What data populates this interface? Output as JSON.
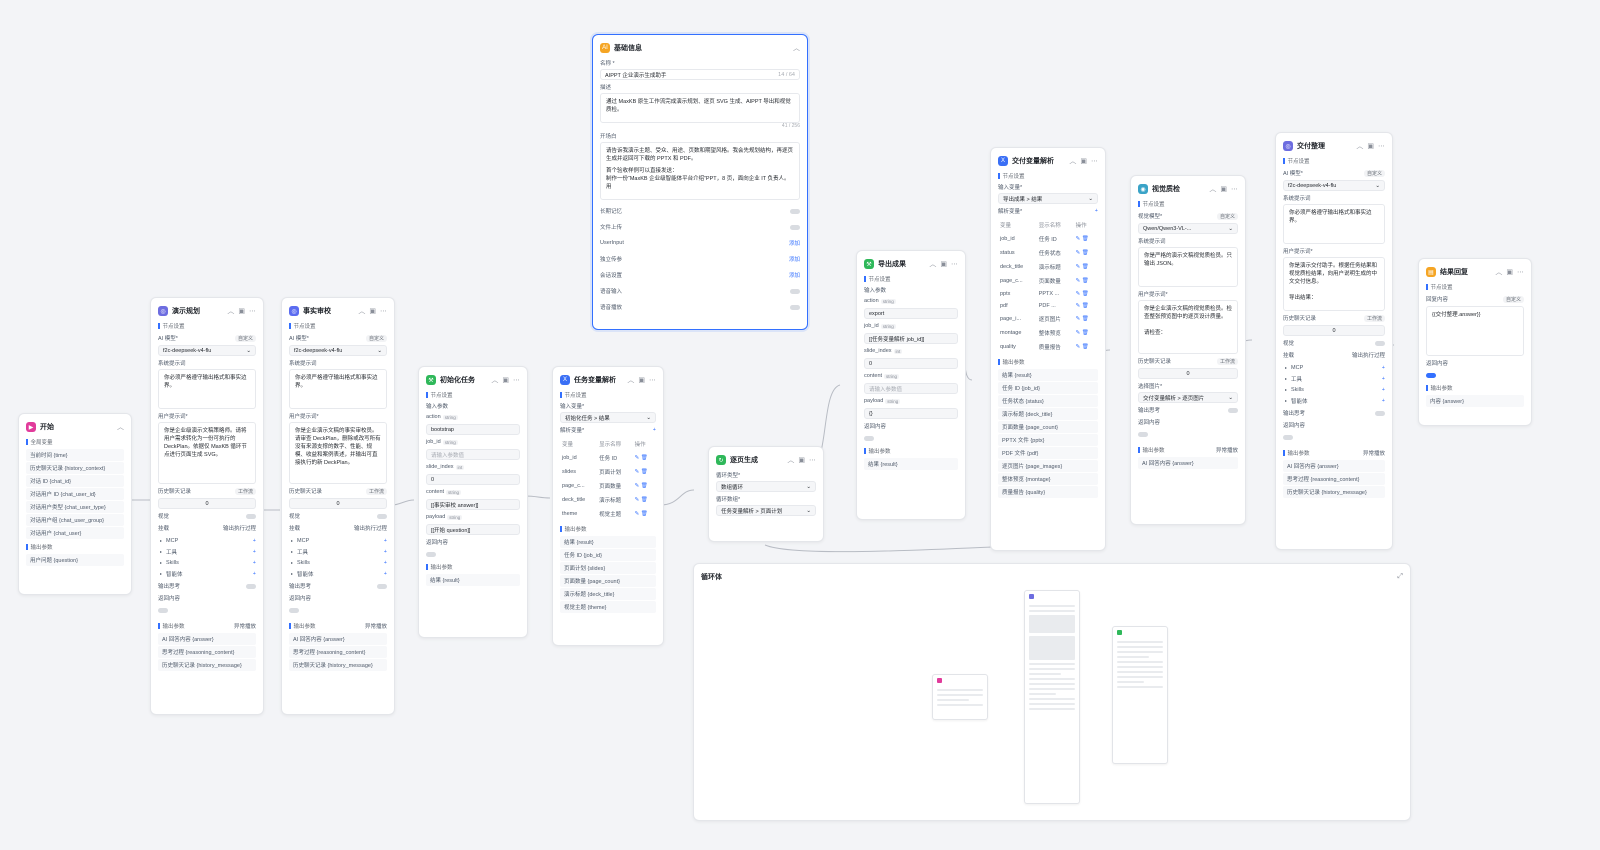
{
  "colors": {
    "accent": "#3370ff",
    "start": "#e13b9b",
    "ai": "#6d6de0",
    "fact": "#5b6cf0",
    "init": "#2fb85a",
    "var": "#3a6ff5",
    "export": "#2fb85a",
    "page": "#2fb85a",
    "base": "#f5a524",
    "deliver": "#3a6ff5",
    "visual": "#3aa3c7",
    "deliver2": "#6d6de0",
    "result": "#f5a524"
  },
  "start": {
    "title": "开始",
    "sec_global": "全局变量",
    "vars": [
      "当前时间 {time}",
      "历史聊天记录 {history_context}",
      "对话 ID {chat_id}",
      "对话用户 ID {chat_user_id}",
      "对话用户类型 {chat_user_type}",
      "对话用户组 {chat_user_group}",
      "对话用户 {chat_user}"
    ],
    "sec_out": "输出参数",
    "out": [
      "用户问题 {question}"
    ]
  },
  "plan": {
    "title": "演示规划",
    "sec_node": "节点设置",
    "model_label": "AI 模型*",
    "model_tag": "自定义",
    "model": "f2c-deepseek-v4-flu",
    "sys_label": "系统提示词",
    "sys": "你必须严格遵守输出格式和事实边界。",
    "user_label": "用户提示词*",
    "user": "你是企业级演示文稿策略师。请将用户需求转化为一份可执行的 DeckPlan。依据仅 MaxKB 循环节点进行页面生成 SVG。",
    "hist_label": "历史聊天记录",
    "hist_mode": "工作流",
    "hist_val": "0",
    "vision": "视觉",
    "mount": "挂载",
    "exec_label": "输出执行过程",
    "tools": [
      "MCP",
      "工具",
      "Skills",
      "智能体"
    ],
    "think": "输出思考",
    "ret": "返回内容",
    "sec_out": "输出参数",
    "stream": "异常播放",
    "out": [
      "AI 回答内容 {answer}",
      "思考过程 {reasoning_content}",
      "历史聊天记录 {history_message}"
    ]
  },
  "fact": {
    "title": "事实审校",
    "sec_node": "节点设置",
    "model_label": "AI 模型*",
    "model_tag": "自定义",
    "model": "f2c-deepseek-v4-flu",
    "sys_label": "系统提示词",
    "sys": "你必须严格遵守输出格式和事实边界。",
    "user_label": "用户提示词*",
    "user": "你是企业演示文稿的事实审校员。请审查 DeckPlan，删除或改写所有没有来源支撑的数字、性能、规模、收益和案例表述，并输出可直接执行的新 DeckPlan。",
    "hist_label": "历史聊天记录",
    "hist_mode": "工作流",
    "hist_val": "0",
    "vision": "视觉",
    "mount": "挂载",
    "exec_label": "输出执行过程",
    "tools": [
      "MCP",
      "工具",
      "Skills",
      "智能体"
    ],
    "think": "输出思考",
    "ret": "返回内容",
    "sec_out": "输出参数",
    "stream": "异常播放",
    "out": [
      "AI 回答内容 {answer}",
      "思考过程 {reasoning_content}",
      "历史聊天记录 {history_message}"
    ]
  },
  "init": {
    "title": "初始化任务",
    "sec_node": "节点设置",
    "sec_in": "输入参数",
    "params": [
      {
        "name": "action",
        "type": "string",
        "value": "bootstrap",
        "ph": false
      },
      {
        "name": "job_id",
        "type": "string",
        "value": "请输入参数值",
        "ph": true
      },
      {
        "name": "slide_index",
        "type": "int",
        "value": "0",
        "ph": false
      },
      {
        "name": "content",
        "type": "string",
        "value": "[[事实审校 answer]]",
        "ph": false
      },
      {
        "name": "payload",
        "type": "string",
        "value": "[[开始 question]]",
        "ph": false
      }
    ],
    "ret": "返回内容",
    "sec_out": "输出参数",
    "out": [
      "结果 {result}"
    ]
  },
  "taskvar": {
    "title": "任务变量解析",
    "sec_node": "节点设置",
    "in_label": "输入变量*",
    "in_val": "初始化任务 > 结果",
    "parse_label": "解析变量*",
    "cols": [
      "变量",
      "显示名称",
      "操作"
    ],
    "rows": [
      [
        "job_id",
        "任务 ID"
      ],
      [
        "slides",
        "页面计划"
      ],
      [
        "page_c...",
        "页面数量"
      ],
      [
        "deck_title",
        "演示标题"
      ],
      [
        "theme",
        "视觉主题"
      ]
    ],
    "sec_out": "输出参数",
    "out": [
      "结果 {result}",
      "任务 ID {job_id}",
      "页面计划 {slides}",
      "页面数量 {page_count}",
      "演示标题 {deck_title}",
      "视觉主题 {theme}"
    ]
  },
  "pagegen": {
    "title": "逐页生成",
    "loop_label": "循环类型*",
    "loop_val": "数组循环",
    "arr_label": "循环数组*",
    "arr_val": "任务变量解析 > 页面计划"
  },
  "export": {
    "title": "导出成果",
    "sec_node": "节点设置",
    "sec_in": "输入参数",
    "params": [
      {
        "name": "action",
        "type": "string",
        "value": "export",
        "ph": false
      },
      {
        "name": "job_id",
        "type": "string",
        "value": "[[任务变量解析 job_id]]",
        "ph": false
      },
      {
        "name": "slide_index",
        "type": "int",
        "value": "0",
        "ph": false
      },
      {
        "name": "content",
        "type": "string",
        "value": "请输入参数值",
        "ph": true
      },
      {
        "name": "payload",
        "type": "string",
        "value": "{}",
        "ph": false
      }
    ],
    "ret": "返回内容",
    "sec_out": "输出参数",
    "out": [
      "结果 {result}"
    ]
  },
  "base": {
    "title": "基础信息",
    "name_label": "名称 *",
    "name": "AIPPT 企业演示生成助手",
    "name_count": "14 / 64",
    "desc_label": "描述",
    "desc": "通过 MaxKB 原生工作流完成演示规划、逐页 SVG 生成、AIPPT 导出和视觉质检。",
    "desc_count": "41 / 256",
    "open_label": "开场白",
    "open": "请告诉我演示主题、受众、用途、页数和期望风格。我会先规划结构，再逐页生成并返回可下载的 PPTX 和 PDF。",
    "open2": "首个验收样例可以直接发送：",
    "open3": "制作一份“MaxKB 企业级智能体平台介绍”PPT，8 页，面向企业 IT 负责人。用",
    "toggles": [
      {
        "label": "长期记忆",
        "on": false
      },
      {
        "label": "文件上传",
        "on": false
      }
    ],
    "adds": [
      {
        "label": "UserInput",
        "add": "添加"
      },
      {
        "label": "独立传参",
        "add": "添加"
      },
      {
        "label": "会话设置",
        "add": "添加"
      }
    ],
    "toggles2": [
      {
        "label": "语音输入",
        "on": false
      },
      {
        "label": "语音播放",
        "on": false
      }
    ]
  },
  "deliver": {
    "title": "交付变量解析",
    "sec_node": "节点设置",
    "in_label": "输入变量*",
    "in_val": "导出成果 > 结果",
    "parse_label": "解析变量*",
    "cols": [
      "变量",
      "显示名称",
      "操作"
    ],
    "rows": [
      [
        "job_id",
        "任务 ID"
      ],
      [
        "status",
        "任务状态"
      ],
      [
        "deck_title",
        "演示标题"
      ],
      [
        "page_c...",
        "页面数量"
      ],
      [
        "pptx",
        "PPTX ..."
      ],
      [
        "pdf",
        "PDF ..."
      ],
      [
        "page_i...",
        "逐页图片"
      ],
      [
        "montage",
        "整体预览"
      ],
      [
        "quality",
        "质量报告"
      ]
    ],
    "sec_out": "输出参数",
    "out": [
      "结果 {result}",
      "任务 ID {job_id}",
      "任务状态 {status}",
      "演示标题 {deck_title}",
      "页面数量 {page_count}",
      "PPTX 文件 {pptx}",
      "PDF 文件 {pdf}",
      "逐页图片 {page_images}",
      "整体预览 {montage}",
      "质量报告 {quality}"
    ]
  },
  "visual": {
    "title": "视觉质检",
    "sec_node": "节点设置",
    "model_label": "视觉模型*",
    "model_tag": "自定义",
    "model": "Qwen/Qwen3-VL-...",
    "sys_label": "系统提示词",
    "sys": "你是严格的演示文稿视觉质检员。只输出 JSON。",
    "user_label": "用户提示词*",
    "user": "你是企业演示文稿的视觉质检员。检查整张预览图中的逐页设计质量。\n\n请检查：",
    "hist_label": "历史聊天记录",
    "hist_mode": "工作流",
    "hist_val": "0",
    "img_label": "选择图片*",
    "img_val": "交付变量解析 > 逐页图片",
    "think": "输出思考",
    "ret": "返回内容",
    "sec_out": "输出参数",
    "stream": "异常播放",
    "out": [
      "AI 回答内容 {answer}"
    ]
  },
  "deliver2": {
    "title": "交付整理",
    "sec_node": "节点设置",
    "model_label": "AI 模型*",
    "model_tag": "自定义",
    "model": "f2c-deepseek-v4-flu",
    "sys_label": "系统提示词",
    "sys": "你必须严格遵守输出格式和事实边界。",
    "user_label": "用户提示词*",
    "user": "你是演示交付助手。根据任务结果和视觉质检结果，向用户说明生成的中文交付信息。\n\n导出结果：",
    "hist_label": "历史聊天记录",
    "hist_mode": "工作流",
    "hist_val": "0",
    "vision": "视觉",
    "mount": "挂载",
    "exec_label": "输出执行过程",
    "tools": [
      "MCP",
      "工具",
      "Skills",
      "智能体"
    ],
    "think": "输出思考",
    "ret": "返回内容",
    "sec_out": "输出参数",
    "stream": "异常播放",
    "out": [
      "AI 回答内容 {answer}",
      "思考过程 {reasoning_content}",
      "历史聊天记录 {history_message}"
    ]
  },
  "result": {
    "title": "结果回复",
    "sec_node": "节点设置",
    "reply_label": "回复内容",
    "reply_tag": "自定义",
    "reply": "{{交付整理.answer}}",
    "ret": "返回内容",
    "sec_out": "输出参数",
    "out": [
      "内容 {answer}"
    ]
  },
  "loop": {
    "title": "循环体"
  }
}
